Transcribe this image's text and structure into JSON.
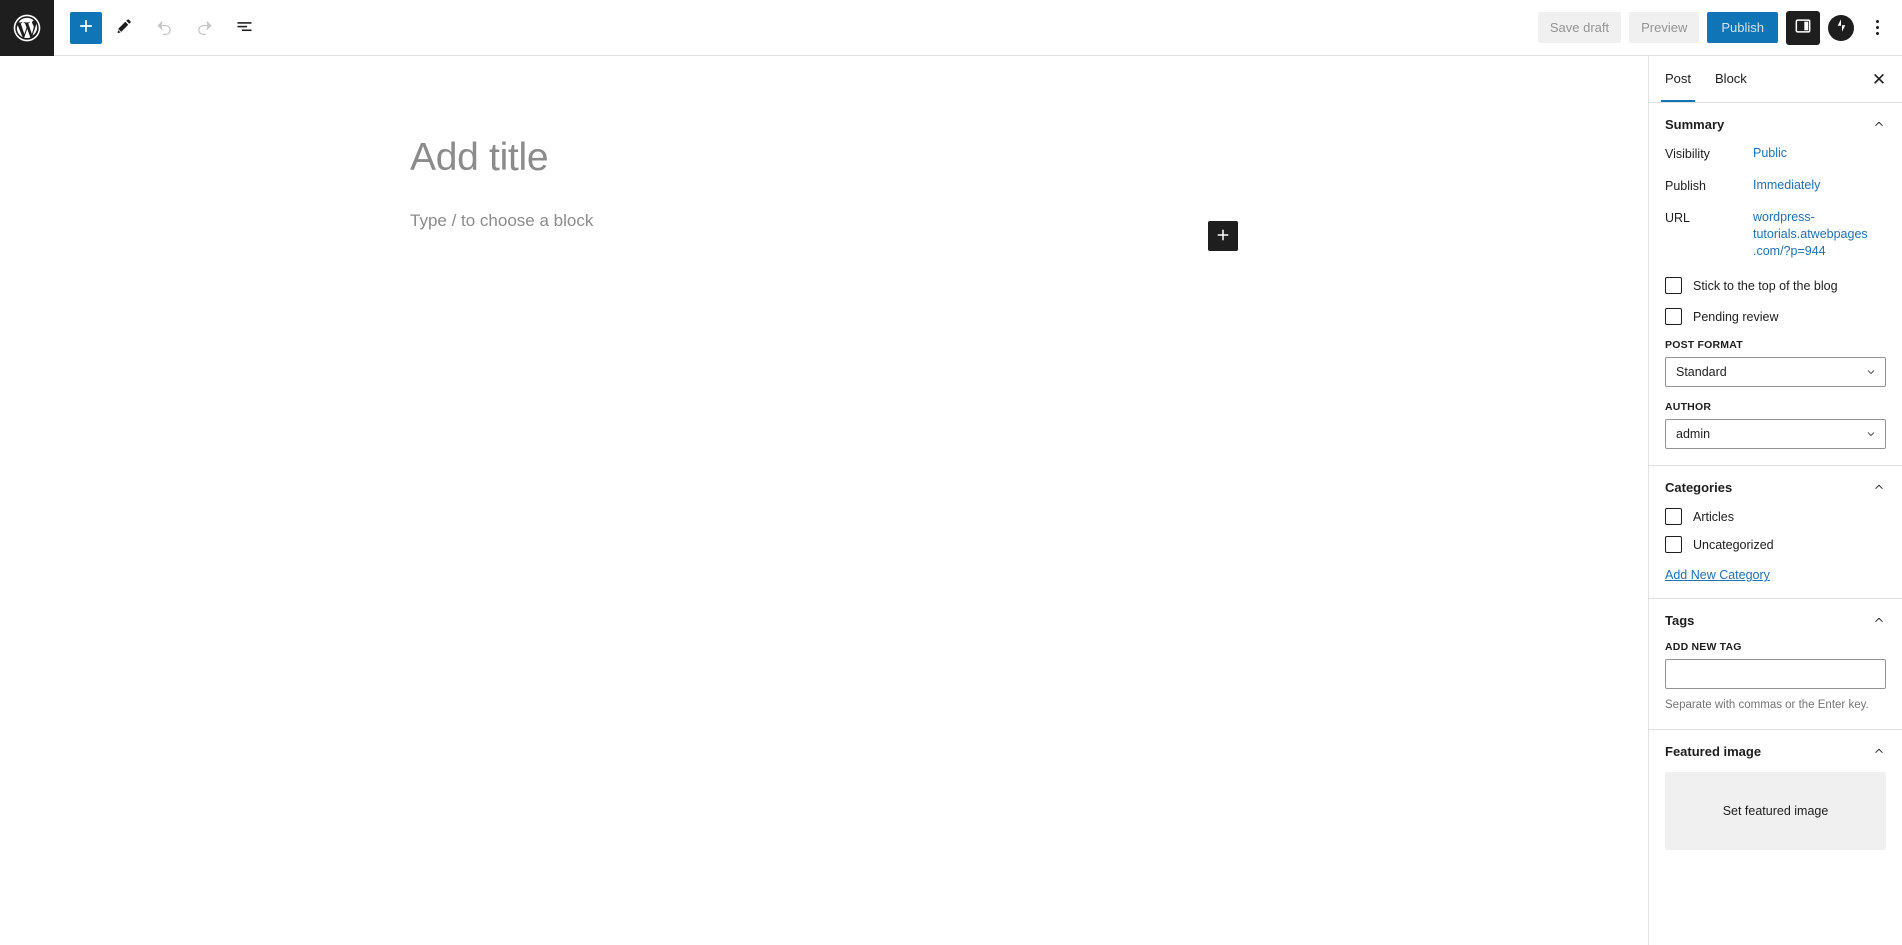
{
  "header": {
    "logo_icon": "wordpress-logo-icon",
    "left_tools": [
      {
        "name": "add-block-button",
        "icon": "plus-icon",
        "state": "primary"
      },
      {
        "name": "edit-tools-button",
        "icon": "pencil-icon",
        "state": "default"
      },
      {
        "name": "undo-button",
        "icon": "undo-arrow-icon",
        "state": "disabled"
      },
      {
        "name": "redo-button",
        "icon": "redo-arrow-icon",
        "state": "disabled"
      },
      {
        "name": "document-overview-button",
        "icon": "list-view-icon",
        "state": "default"
      }
    ],
    "save_draft_label": "Save draft",
    "preview_label": "Preview",
    "publish_label": "Publish",
    "settings_toggle_icon": "sidebar-panel-icon",
    "avatar_icon": "jetpack-logo-icon",
    "more_options_icon": "three-dots-vertical-icon",
    "accent_color": "#1075b6"
  },
  "canvas": {
    "title_placeholder": "Add title",
    "block_placeholder": "Type / to choose a block",
    "inserter_icon": "plus-icon"
  },
  "sidebar": {
    "tabs": [
      {
        "label": "Post",
        "active": true
      },
      {
        "label": "Block",
        "active": false
      }
    ],
    "close_icon": "close-icon",
    "summary": {
      "title": "Summary",
      "rows": [
        {
          "label": "Visibility",
          "value": "Public"
        },
        {
          "label": "Publish",
          "value": "Immediately"
        },
        {
          "label": "URL",
          "value": "wordpress-tutorials.atwebpages.com/?p=944"
        }
      ],
      "checkboxes": [
        {
          "label": "Stick to the top of the blog",
          "checked": false
        },
        {
          "label": "Pending review",
          "checked": false
        }
      ],
      "post_format_label": "POST FORMAT",
      "post_format_value": "Standard",
      "author_label": "AUTHOR",
      "author_value": "admin"
    },
    "categories": {
      "title": "Categories",
      "items": [
        {
          "label": "Articles",
          "checked": false
        },
        {
          "label": "Uncategorized",
          "checked": false
        }
      ],
      "add_new_link": "Add New Category"
    },
    "tags": {
      "title": "Tags",
      "add_new_label": "ADD NEW TAG",
      "input_value": "",
      "input_placeholder": "",
      "help_text": "Separate with commas or the Enter key."
    },
    "featured_image": {
      "title": "Featured image",
      "set_label": "Set featured image"
    },
    "link_color": "#2271b1"
  }
}
